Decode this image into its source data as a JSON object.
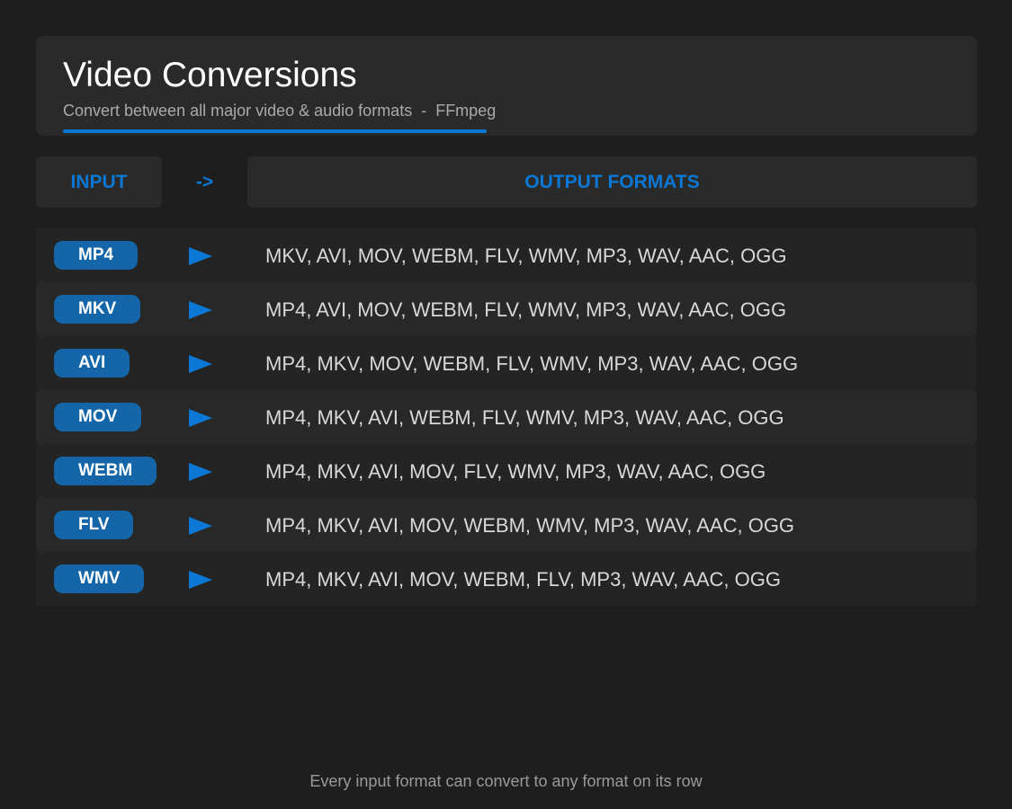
{
  "header": {
    "title": "Video Conversions",
    "subtitle": "Convert between all major video & audio formats  -  FFmpeg"
  },
  "columns": {
    "input_label": "INPUT",
    "arrow_label": "->",
    "output_label": "OUTPUT FORMATS"
  },
  "rows": [
    {
      "input": "MP4",
      "outputs": "MKV, AVI, MOV, WEBM, FLV, WMV, MP3, WAV, AAC, OGG"
    },
    {
      "input": "MKV",
      "outputs": "MP4, AVI, MOV, WEBM, FLV, WMV, MP3, WAV, AAC, OGG"
    },
    {
      "input": "AVI",
      "outputs": "MP4, MKV, MOV, WEBM, FLV, WMV, MP3, WAV, AAC, OGG"
    },
    {
      "input": "MOV",
      "outputs": "MP4, MKV, AVI, WEBM, FLV, WMV, MP3, WAV, AAC, OGG"
    },
    {
      "input": "WEBM",
      "outputs": "MP4, MKV, AVI, MOV, FLV, WMV, MP3, WAV, AAC, OGG"
    },
    {
      "input": "FLV",
      "outputs": "MP4, MKV, AVI, MOV, WEBM, WMV, MP3, WAV, AAC, OGG"
    },
    {
      "input": "WMV",
      "outputs": "MP4, MKV, AVI, MOV, WEBM, FLV, MP3, WAV, AAC, OGG"
    }
  ],
  "footer": {
    "note": "Every input format can convert to any format on its row"
  },
  "icons": {
    "row_arrow": "play-triangle-icon"
  },
  "colors": {
    "accent": "#0b78d6",
    "pill": "#1466a8",
    "background": "#1e1e1e",
    "panel": "#2a2a2a"
  }
}
